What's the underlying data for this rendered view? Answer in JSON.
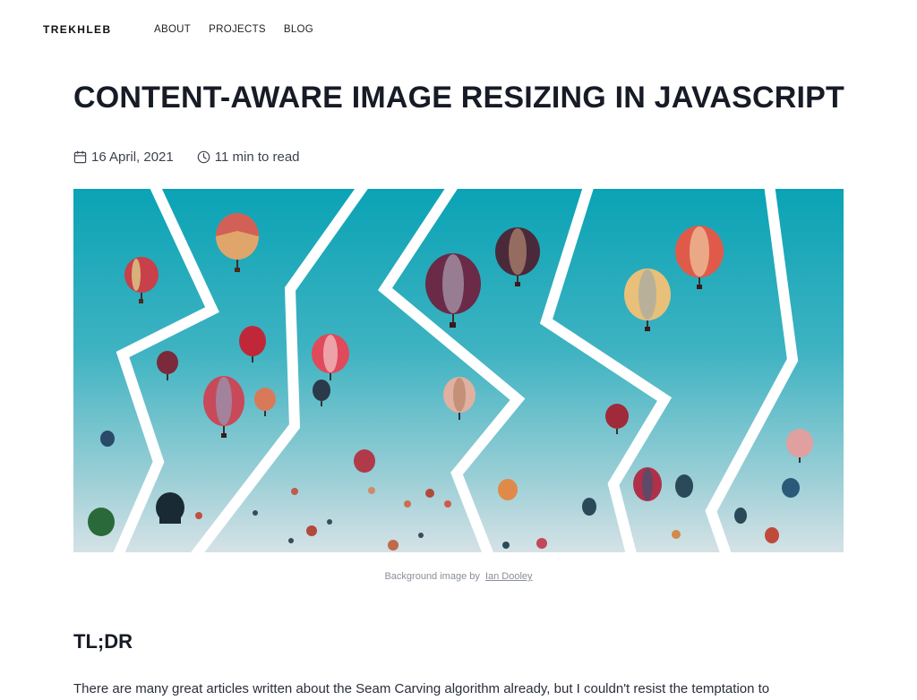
{
  "nav": {
    "brand": "TREKHLEB",
    "links": [
      "ABOUT",
      "PROJECTS",
      "BLOG"
    ]
  },
  "article": {
    "title": "CONTENT-AWARE IMAGE RESIZING IN JAVASCRIPT",
    "date": "16 April, 2021",
    "read_time": "11 min to read",
    "date_icon": "calendar-icon",
    "read_time_icon": "clock-icon",
    "hero_alt": "Hot air balloons in the sky",
    "caption_prefix": "Background image by",
    "caption_author": "Ian Dooley",
    "section_heading": "TL;DR",
    "intro_text": "There are many great articles written about the Seam Carving algorithm already, but I couldn't resist the temptation to"
  },
  "colors": {
    "sky_top": "#0aa3b5",
    "sky_bottom": "#d5e2e6",
    "text_dark": "#161b26",
    "caption_gray": "#8a8f99"
  }
}
